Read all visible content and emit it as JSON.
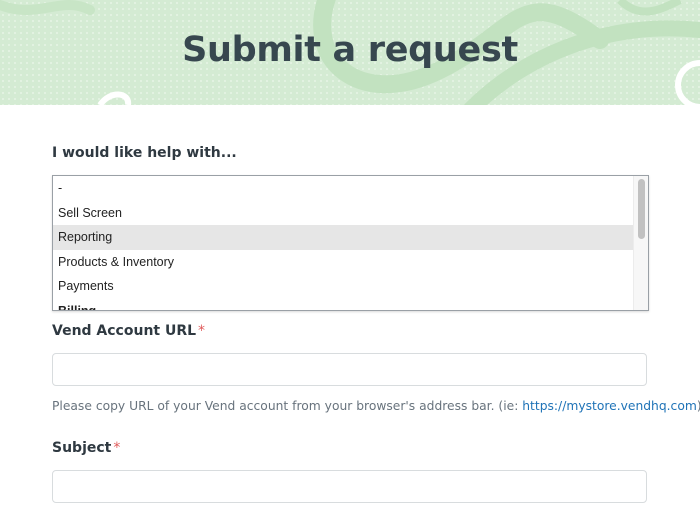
{
  "page": {
    "title": "Submit a request"
  },
  "form": {
    "help_with": {
      "label": "I would like help with...",
      "options": [
        "-",
        "Sell Screen",
        "Reporting",
        "Products & Inventory",
        "Payments",
        "Billing"
      ],
      "selected": "Reporting"
    },
    "account_url": {
      "label": "Vend Account URL",
      "required_mark": "*",
      "value": "",
      "placeholder": "",
      "hint_text": "Please copy URL of your Vend account from your browser's address bar. (ie: ",
      "hint_link": "https://mystore.vendhq.com",
      "hint_suffix": ")"
    },
    "subject": {
      "label": "Subject",
      "required_mark": "*",
      "value": "",
      "placeholder": ""
    }
  },
  "colors": {
    "hero_bg": "#d4ebd3",
    "title": "#37474f",
    "required": "#e05a5a",
    "link": "#1f73b7",
    "selected_option_bg": "#e6e6e6"
  }
}
